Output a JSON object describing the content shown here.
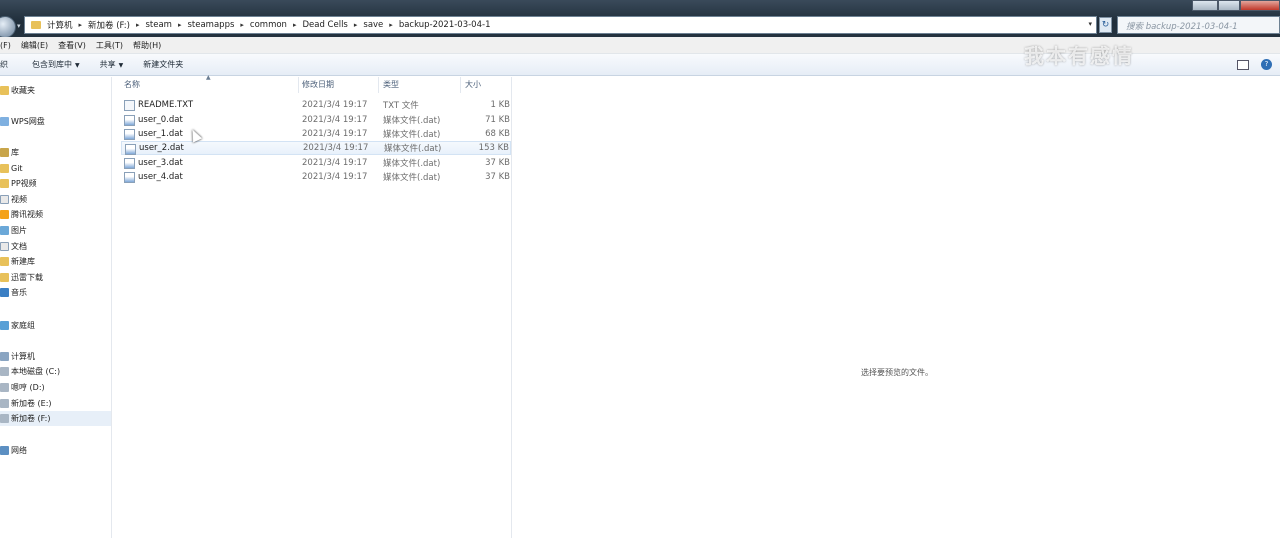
{
  "address_bar": {
    "crumbs": [
      "计算机",
      "新加卷 (F:)",
      "steam",
      "steamapps",
      "common",
      "Dead Cells",
      "save",
      "backup-2021-03-04-1"
    ]
  },
  "search": {
    "placeholder": "搜索 backup-2021-03-04-1"
  },
  "menu": [
    "(F)",
    "编辑(E)",
    "查看(V)",
    "工具(T)",
    "帮助(H)"
  ],
  "toolbar": {
    "organize": "织",
    "include": "包含到库中",
    "share": "共享",
    "new_folder": "新建文件夹"
  },
  "watermark": "我本有感情",
  "nav": [
    {
      "label": "收藏夹",
      "icon": "favorites-icon"
    },
    {
      "label": "WPS网盘",
      "icon": "cloud-icon"
    },
    {
      "label": "库",
      "icon": "library-icon"
    },
    {
      "label": "Git",
      "icon": "folder-icon"
    },
    {
      "label": "PP视频",
      "icon": "folder-icon"
    },
    {
      "label": "视频",
      "icon": "video-icon"
    },
    {
      "label": "腾讯视频",
      "icon": "tencent-video-icon"
    },
    {
      "label": "图片",
      "icon": "pictures-icon"
    },
    {
      "label": "文档",
      "icon": "documents-icon"
    },
    {
      "label": "新建库",
      "icon": "folder-icon"
    },
    {
      "label": "迅雷下载",
      "icon": "folder-icon"
    },
    {
      "label": "音乐",
      "icon": "music-icon"
    },
    {
      "label": "家庭组",
      "icon": "homegroup-icon"
    },
    {
      "label": "计算机",
      "icon": "computer-icon"
    },
    {
      "label": "本地磁盘 (C:)",
      "icon": "drive-icon"
    },
    {
      "label": "嗯哼 (D:)",
      "icon": "drive-icon"
    },
    {
      "label": "新加卷 (E:)",
      "icon": "drive-icon"
    },
    {
      "label": "新加卷 (F:)",
      "icon": "drive-icon"
    },
    {
      "label": "网络",
      "icon": "network-icon"
    }
  ],
  "columns": {
    "name": "名称",
    "date": "修改日期",
    "type": "类型",
    "size": "大小"
  },
  "files": [
    {
      "name": "README.TXT",
      "date": "2021/3/4 19:17",
      "type": "TXT 文件",
      "size": "1 KB",
      "icon": "text-file-icon"
    },
    {
      "name": "user_0.dat",
      "date": "2021/3/4 19:17",
      "type": "媒体文件(.dat)",
      "size": "71 KB",
      "icon": "media-file-icon"
    },
    {
      "name": "user_1.dat",
      "date": "2021/3/4 19:17",
      "type": "媒体文件(.dat)",
      "size": "68 KB",
      "icon": "media-file-icon"
    },
    {
      "name": "user_2.dat",
      "date": "2021/3/4 19:17",
      "type": "媒体文件(.dat)",
      "size": "153 KB",
      "icon": "media-file-icon"
    },
    {
      "name": "user_3.dat",
      "date": "2021/3/4 19:17",
      "type": "媒体文件(.dat)",
      "size": "37 KB",
      "icon": "media-file-icon"
    },
    {
      "name": "user_4.dat",
      "date": "2021/3/4 19:17",
      "type": "媒体文件(.dat)",
      "size": "37 KB",
      "icon": "media-file-icon"
    }
  ],
  "preview": {
    "message": "选择要预览的文件。"
  }
}
